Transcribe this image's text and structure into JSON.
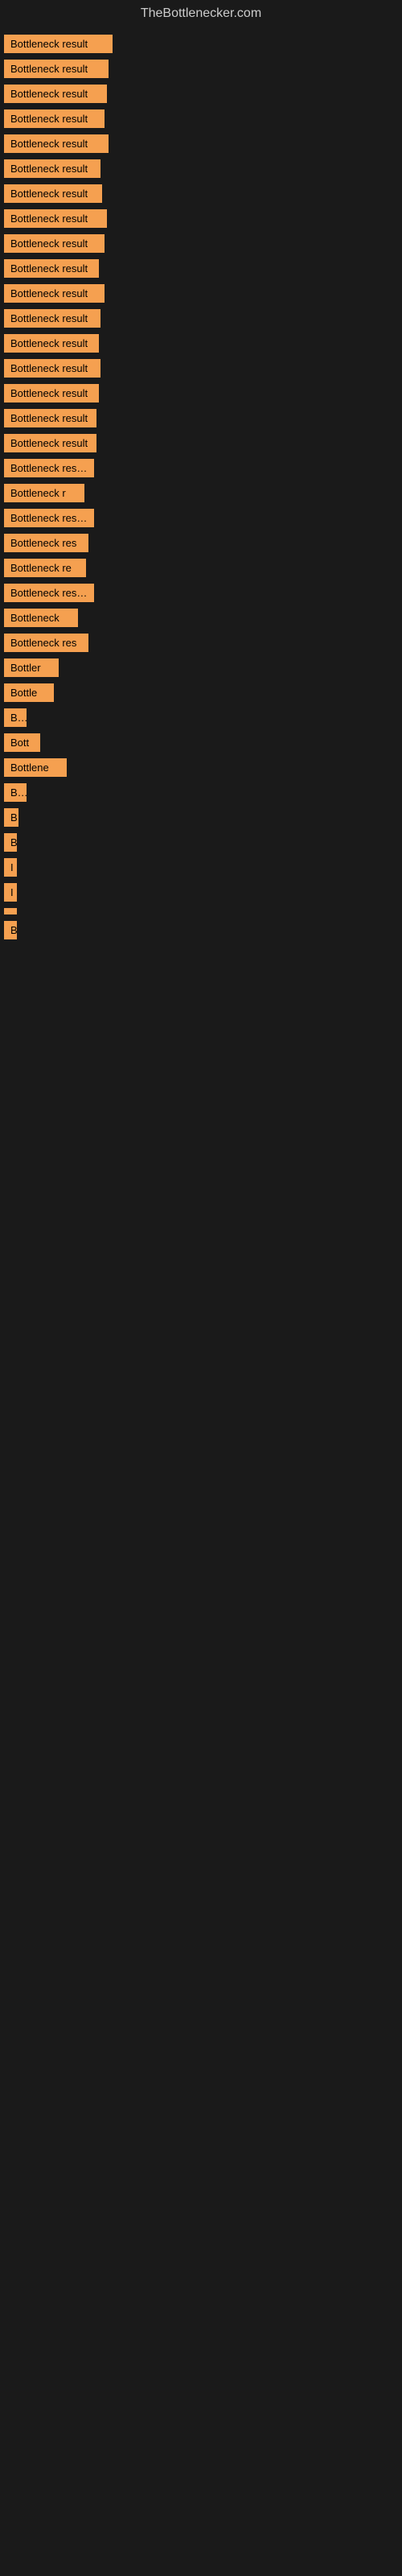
{
  "site": {
    "title": "TheBottlenecker.com"
  },
  "results": [
    {
      "label": "Bottleneck result",
      "width": 135
    },
    {
      "label": "Bottleneck result",
      "width": 130
    },
    {
      "label": "Bottleneck result",
      "width": 128
    },
    {
      "label": "Bottleneck result",
      "width": 125
    },
    {
      "label": "Bottleneck result",
      "width": 130
    },
    {
      "label": "Bottleneck result",
      "width": 120
    },
    {
      "label": "Bottleneck result",
      "width": 122
    },
    {
      "label": "Bottleneck result",
      "width": 128
    },
    {
      "label": "Bottleneck result",
      "width": 125
    },
    {
      "label": "Bottleneck result",
      "width": 118
    },
    {
      "label": "Bottleneck result",
      "width": 125
    },
    {
      "label": "Bottleneck result",
      "width": 120
    },
    {
      "label": "Bottleneck result",
      "width": 118
    },
    {
      "label": "Bottleneck result",
      "width": 120
    },
    {
      "label": "Bottleneck result",
      "width": 118
    },
    {
      "label": "Bottleneck result",
      "width": 115
    },
    {
      "label": "Bottleneck result",
      "width": 115
    },
    {
      "label": "Bottleneck result",
      "width": 112
    },
    {
      "label": "Bottleneck r",
      "width": 100
    },
    {
      "label": "Bottleneck result",
      "width": 112
    },
    {
      "label": "Bottleneck res",
      "width": 105
    },
    {
      "label": "Bottleneck re",
      "width": 102
    },
    {
      "label": "Bottleneck result",
      "width": 112
    },
    {
      "label": "Bottleneck",
      "width": 92
    },
    {
      "label": "Bottleneck res",
      "width": 105
    },
    {
      "label": "Bottler",
      "width": 68
    },
    {
      "label": "Bottle",
      "width": 62
    },
    {
      "label": "Bo",
      "width": 28
    },
    {
      "label": "Bott",
      "width": 45
    },
    {
      "label": "Bottlene",
      "width": 78
    },
    {
      "label": "Bo",
      "width": 28
    },
    {
      "label": "B",
      "width": 18
    },
    {
      "label": "B",
      "width": 14
    },
    {
      "label": "I",
      "width": 8
    },
    {
      "label": "I",
      "width": 8
    },
    {
      "label": "",
      "width": 8
    },
    {
      "label": "B",
      "width": 14
    }
  ]
}
